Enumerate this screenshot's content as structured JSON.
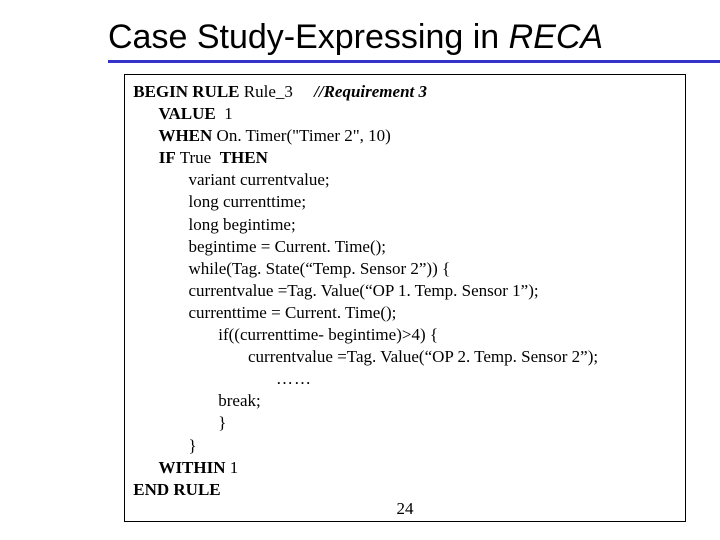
{
  "title_plain": "Case Study-Expressing in ",
  "title_italic": "RECA",
  "page_number": "24",
  "code": {
    "l1a": " BEGIN RULE",
    "l1b": " Rule_3     ",
    "l1c": "//Requirement 3",
    "l2a": "       VALUE",
    "l2b": "  1",
    "l3a": "       WHEN",
    "l3b": " On. Timer(\"Timer 2\", 10)",
    "l4a": "       IF",
    "l4b": " True  ",
    "l4c": "THEN",
    "l5": "              variant currentvalue;",
    "l6": "              long currenttime;",
    "l7": "              long begintime;",
    "l8": "              begintime = Current. Time();",
    "l9": "              while(Tag. State(“Temp. Sensor 2”)) {",
    "l10": "              currentvalue =Tag. Value(“OP 1. Temp. Sensor 1”);",
    "l11": "              currenttime = Current. Time();",
    "l12": "                     if((currenttime- begintime)>4) {",
    "l13": "                            currentvalue =Tag. Value(“OP 2. Temp. Sensor 2”);",
    "l14": "                            ……",
    "l15": "                     break;",
    "l16": "                     }",
    "l17": "              }",
    "l18a": "       WITHIN",
    "l18b": " 1",
    "l19": " END RULE"
  }
}
